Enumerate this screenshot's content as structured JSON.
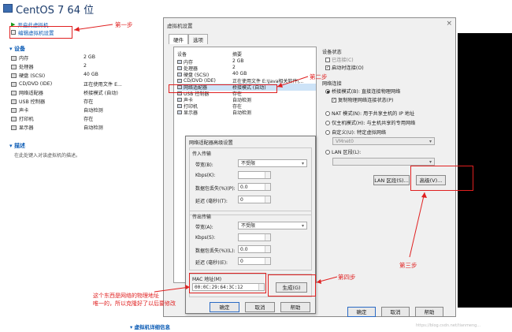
{
  "window": {
    "title": "CentOS 7 64 位"
  },
  "left": {
    "actions": [
      "开启此虚拟机",
      "编辑虚拟机设置"
    ],
    "devices_title": "设备",
    "devices": [
      {
        "name": "内存",
        "value": "2 GB"
      },
      {
        "name": "处理器",
        "value": "2"
      },
      {
        "name": "硬盘 (SCSI)",
        "value": "40 GB"
      },
      {
        "name": "CD/DVD (IDE)",
        "value": "正在使用文件 E..."
      },
      {
        "name": "网络适配器",
        "value": "桥接模式 (自动)"
      },
      {
        "name": "USB 控制器",
        "value": "存在"
      },
      {
        "name": "声卡",
        "value": "自动检测"
      },
      {
        "name": "打印机",
        "value": "存在"
      },
      {
        "name": "显示器",
        "value": "自动检测"
      }
    ],
    "desc_title": "描述",
    "desc_placeholder": "在此处键入对该虚拟机的描述。",
    "details_link": "虚拟机详细信息"
  },
  "dialog": {
    "title": "虚拟机设置",
    "close": "×",
    "tabs": [
      "硬件",
      "选项"
    ],
    "list_headers": [
      "设备",
      "摘要"
    ],
    "devices": [
      {
        "name": "内存",
        "value": "2 GB"
      },
      {
        "name": "处理器",
        "value": "2"
      },
      {
        "name": "硬盘 (SCSI)",
        "value": "40 GB"
      },
      {
        "name": "CD/DVD (IDE)",
        "value": "正在使用文件 E:\\Java相关软件\\..."
      },
      {
        "name": "网络适配器",
        "value": "桥接模式 (自动)"
      },
      {
        "name": "USB 控制器",
        "value": "存在"
      },
      {
        "name": "声卡",
        "value": "自动检测"
      },
      {
        "name": "打印机",
        "value": "存在"
      },
      {
        "name": "显示器",
        "value": "自动检测"
      }
    ],
    "status": {
      "title": "设备状态",
      "connected": "已连接(C)",
      "connect_on_power": "启动时连接(O)"
    },
    "connection": {
      "title": "网络连接",
      "bridged": "桥接模式(B): 直接连接物理网络",
      "replicate": "复制物理网络连接状态(P)",
      "nat": "NAT 模式(N): 用于共享主机的 IP 地址",
      "host_only": "仅主机模式(H): 与主机共享的专用网络",
      "custom": "自定义(U): 特定虚拟网络",
      "custom_value": "VMnet0",
      "lan": "LAN 区段(L):"
    },
    "lan_button": "LAN 区段(S)...",
    "advanced_button": "高级(V)...",
    "ok": "确定",
    "cancel": "取消",
    "help": "帮助"
  },
  "advanced": {
    "title": "网络适配器高级设置",
    "incoming": {
      "title": "传入传输",
      "bandwidth_label": "带宽(B):",
      "bandwidth_value": "不受限",
      "kbps_label": "Kbps(K):",
      "loss_label": "数据包丢失(%)(P):",
      "loss_value": "0.0",
      "latency_label": "延迟 (毫秒)(T):",
      "latency_value": "0"
    },
    "outgoing": {
      "title": "传出传输",
      "bandwidth_label": "带宽(A):",
      "bandwidth_value": "不受限",
      "kbps_label": "Kbps(S):",
      "loss_label": "数据包丢失(%)(L):",
      "loss_value": "0.0",
      "latency_label": "延迟 (毫秒)(E):",
      "latency_value": "0"
    },
    "mac_label": "MAC 地址(M)",
    "mac_value": "00:0C:29:64:3C:12",
    "generate": "生成(G)",
    "ok": "确定",
    "cancel": "取消",
    "help": "帮助"
  },
  "annotations": {
    "step1": "第一步",
    "step2": "第二步",
    "step3": "第三步",
    "step4": "第四步",
    "note_line1": "这个东西是网络的物理地址",
    "note_line2": "唯一的，所以克隆好了以后要修改"
  },
  "watermark": "https://blog.csdn.net/tianmeng...",
  "colors": {
    "annotation": "#e02020",
    "link": "#0b5bb5",
    "title": "#1a3a6a"
  }
}
